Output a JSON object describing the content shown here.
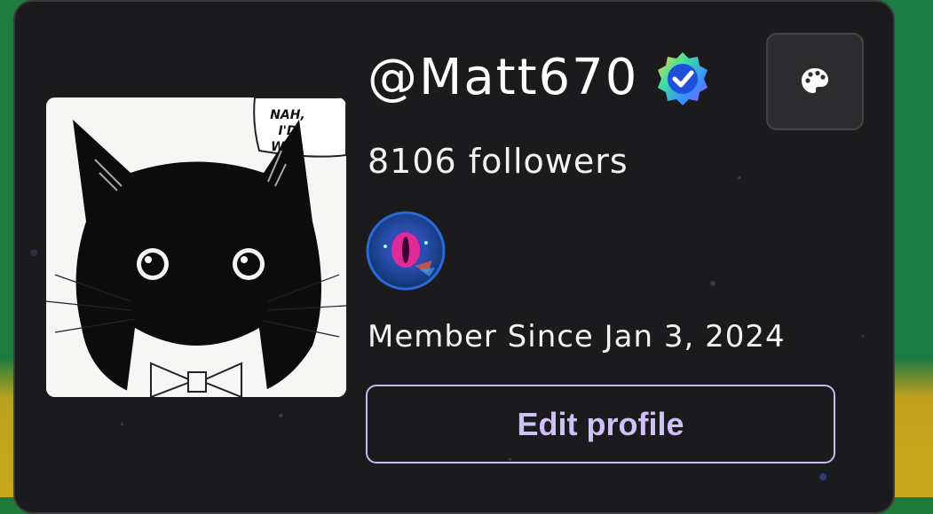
{
  "profile": {
    "username": "@Matt670",
    "verified_icon": "verified-badge-icon",
    "followers_text": "8106 followers",
    "member_since": "Member Since Jan 3, 2024",
    "edit_button_label": "Edit profile",
    "avatar_caption": [
      "NAH,",
      "I'D",
      "WIN."
    ],
    "palette_icon": "palette-icon",
    "orb_icon": "cat-eye-orb-icon"
  },
  "colors": {
    "card_bg": "#1b1b1d",
    "accent": "#cfc0f7",
    "text": "#f2f2f2"
  }
}
